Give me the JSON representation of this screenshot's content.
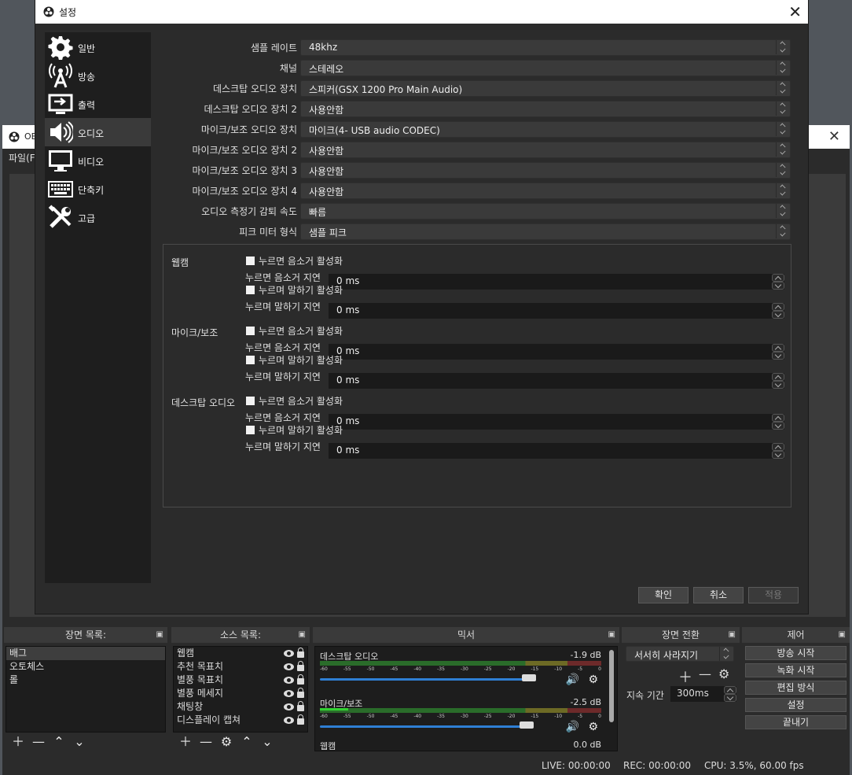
{
  "background_window": {
    "title": "OB",
    "menu_file": "파일(F"
  },
  "dialog": {
    "title": "설정",
    "nav": [
      {
        "label": "일반",
        "icon": "gear-icon"
      },
      {
        "label": "방송",
        "icon": "antenna-icon"
      },
      {
        "label": "출력",
        "icon": "output-icon"
      },
      {
        "label": "오디오",
        "icon": "speaker-icon"
      },
      {
        "label": "비디오",
        "icon": "monitor-icon"
      },
      {
        "label": "단축키",
        "icon": "keyboard-icon"
      },
      {
        "label": "고급",
        "icon": "tools-icon"
      }
    ],
    "active_nav": "오디오",
    "audio_settings": [
      {
        "label": "샘플 레이트",
        "value": "48khz"
      },
      {
        "label": "채널",
        "value": "스테레오"
      },
      {
        "label": "데스크탑 오디오 장치",
        "value": "스피커(GSX 1200 Pro Main Audio)"
      },
      {
        "label": "데스크탑 오디오 장치 2",
        "value": "사용안함"
      },
      {
        "label": "마이크/보조 오디오 장치",
        "value": "마이크(4- USB audio CODEC)"
      },
      {
        "label": "마이크/보조 오디오 장치 2",
        "value": "사용안함"
      },
      {
        "label": "마이크/보조 오디오 장치 3",
        "value": "사용안함"
      },
      {
        "label": "마이크/보조 오디오 장치 4",
        "value": "사용안함"
      },
      {
        "label": "오디오 측정기 감퇴 속도",
        "value": "빠름"
      },
      {
        "label": "피크 미터 형식",
        "value": "샘플 피크"
      }
    ],
    "hotkey_groups": [
      {
        "name": "웹캠",
        "push_to_mute": "누르면 음소거 활성화",
        "push_to_mute_delay_label": "누르면 음소거 지연",
        "push_to_mute_delay": "0 ms",
        "push_to_talk": "누르며 말하기 활성화",
        "push_to_talk_delay_label": "누르며 말하기 지연",
        "push_to_talk_delay": "0 ms"
      },
      {
        "name": "마이크/보조",
        "push_to_mute": "누르면 음소거 활성화",
        "push_to_mute_delay_label": "누르면 음소거 지연",
        "push_to_mute_delay": "0 ms",
        "push_to_talk": "누르며 말하기 활성화",
        "push_to_talk_delay_label": "누르며 말하기 지연",
        "push_to_talk_delay": "0 ms"
      },
      {
        "name": "데스크탑 오디오",
        "push_to_mute": "누르면 음소거 활성화",
        "push_to_mute_delay_label": "누르면 음소거 지연",
        "push_to_mute_delay": "0 ms",
        "push_to_talk": "누르며 말하기 활성화",
        "push_to_talk_delay_label": "누르며 말하기 지연",
        "push_to_talk_delay": "0 ms"
      }
    ],
    "buttons": {
      "ok": "확인",
      "cancel": "취소",
      "apply": "적용"
    }
  },
  "docks": {
    "scenes": {
      "title": "장면 목록:",
      "items": [
        "배그",
        "오토체스",
        "롤"
      ]
    },
    "sources": {
      "title": "소스 목록:",
      "items": [
        "웹캠",
        "추천 목표치",
        "별풍 목표치",
        "별풍 메세지",
        "채팅창",
        "디스플레이 캡쳐"
      ]
    },
    "mixer": {
      "title": "믹서",
      "channels": [
        {
          "name": "데스크탑 오디오",
          "db": "-1.9 dB",
          "level": 0.0,
          "volume": 0.92
        },
        {
          "name": "마이크/보조",
          "db": "-2.5 dB",
          "level": 0.1,
          "volume": 0.91
        },
        {
          "name": "웹캠",
          "db": "0.0 dB"
        }
      ],
      "ticks": [
        "-60",
        "-55",
        "-50",
        "-45",
        "-40",
        "-35",
        "-30",
        "-25",
        "-20",
        "-15",
        "-10",
        "-5",
        "0"
      ]
    },
    "transitions": {
      "title": "장면 전환",
      "type": "서서히 사라지기",
      "duration_label": "지속 기간",
      "duration": "300ms"
    },
    "controls": {
      "title": "제어",
      "buttons": [
        "방송 시작",
        "녹화 시작",
        "편집 방식",
        "설정",
        "끝내기"
      ]
    }
  },
  "status": {
    "live": "LIVE: 00:00:00",
    "rec": "REC: 00:00:00",
    "cpu": "CPU: 3.5%, 60.00 fps"
  }
}
